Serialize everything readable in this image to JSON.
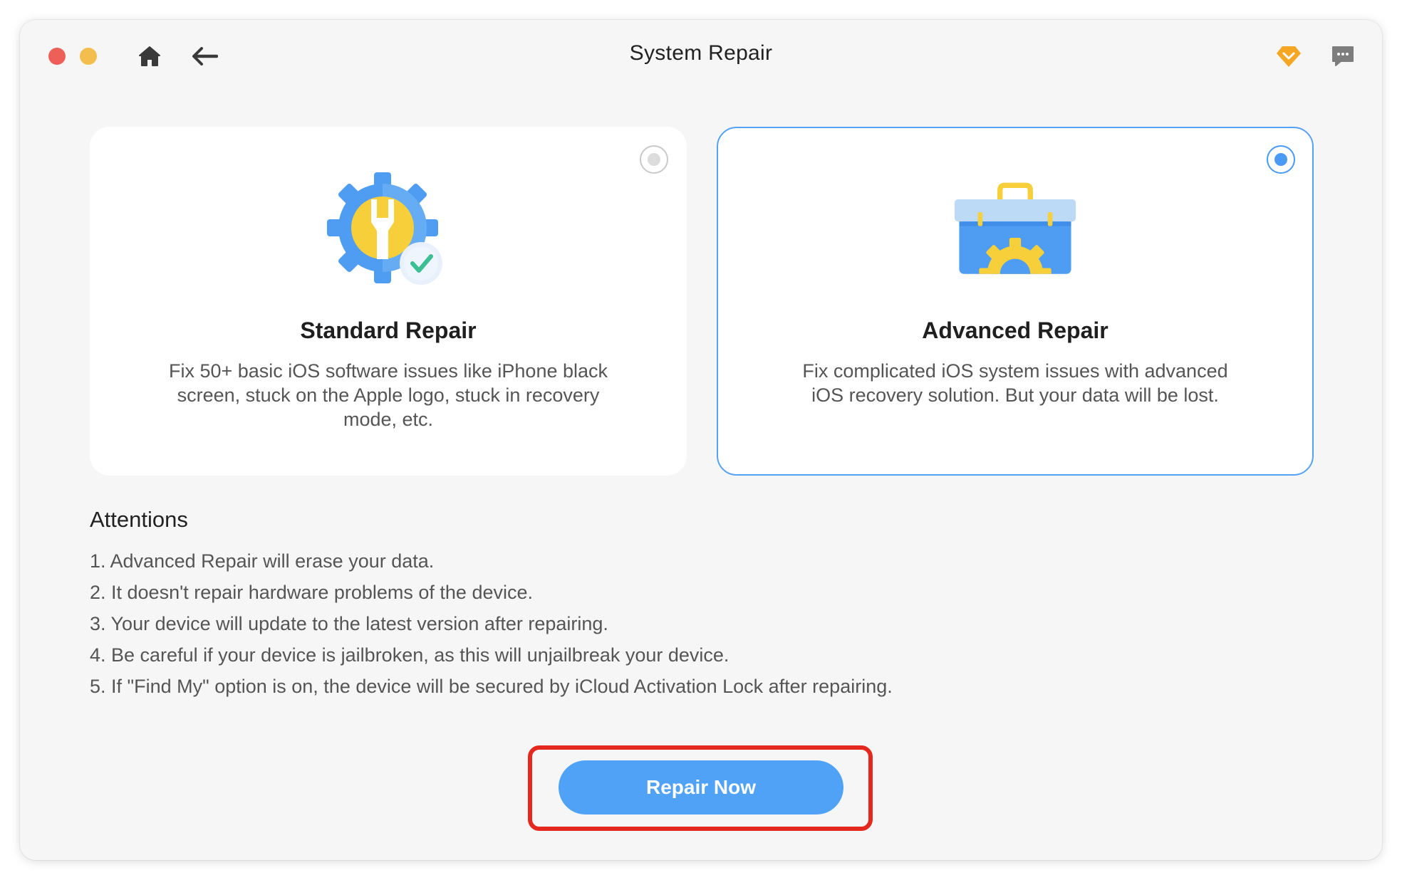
{
  "window": {
    "title": "System Repair"
  },
  "options": [
    {
      "id": "standard",
      "title": "Standard Repair",
      "description": "Fix 50+ basic iOS software issues like iPhone black screen, stuck on the Apple logo, stuck in recovery mode, etc.",
      "selected": false,
      "icon": "gear-wrench-check-icon"
    },
    {
      "id": "advanced",
      "title": "Advanced Repair",
      "description": "Fix complicated iOS system issues with advanced iOS recovery solution. But your data will be lost.",
      "selected": true,
      "icon": "toolbox-icon"
    }
  ],
  "attentions": {
    "title": "Attentions",
    "items": [
      "1. Advanced Repair will erase your data.",
      "2. It doesn't repair hardware problems of the device.",
      "3. Your device will update to the latest version after repairing.",
      "4. Be careful if your device is jailbroken, as this will unjailbreak your device.",
      "5. If \"Find My\" option is on, the device will be secured by iCloud Activation Lock after repairing."
    ]
  },
  "actions": {
    "repair_now": "Repair Now"
  },
  "colors": {
    "accent": "#4fa2f6",
    "selected_border": "#55a2f5",
    "highlight_box": "#e4281e",
    "window_bg": "#f6f6f6"
  }
}
